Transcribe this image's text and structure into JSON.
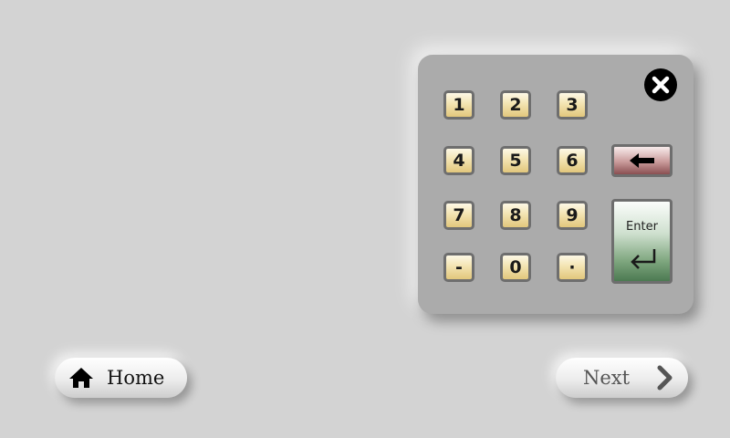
{
  "keypad": {
    "keys": [
      {
        "label": "1"
      },
      {
        "label": "2"
      },
      {
        "label": "3"
      },
      {
        "label": "4"
      },
      {
        "label": "5"
      },
      {
        "label": "6"
      },
      {
        "label": "7"
      },
      {
        "label": "8"
      },
      {
        "label": "9"
      },
      {
        "label": "-"
      },
      {
        "label": "0"
      },
      {
        "label": "·"
      }
    ],
    "enter_label": "Enter",
    "close_icon": "close-icon",
    "backspace_icon": "arrow-left-icon",
    "enter_icon": "return-arrow-icon"
  },
  "nav": {
    "home_label": "Home",
    "home_icon": "home-icon",
    "next_label": "Next",
    "next_icon": "chevron-right-icon"
  },
  "colors": {
    "background": "#d3d3d3",
    "keypad_panel": "#ababab",
    "key_gold": "#e2c77c",
    "backspace_red": "#8a4f52",
    "enter_green": "#4c7a52"
  }
}
